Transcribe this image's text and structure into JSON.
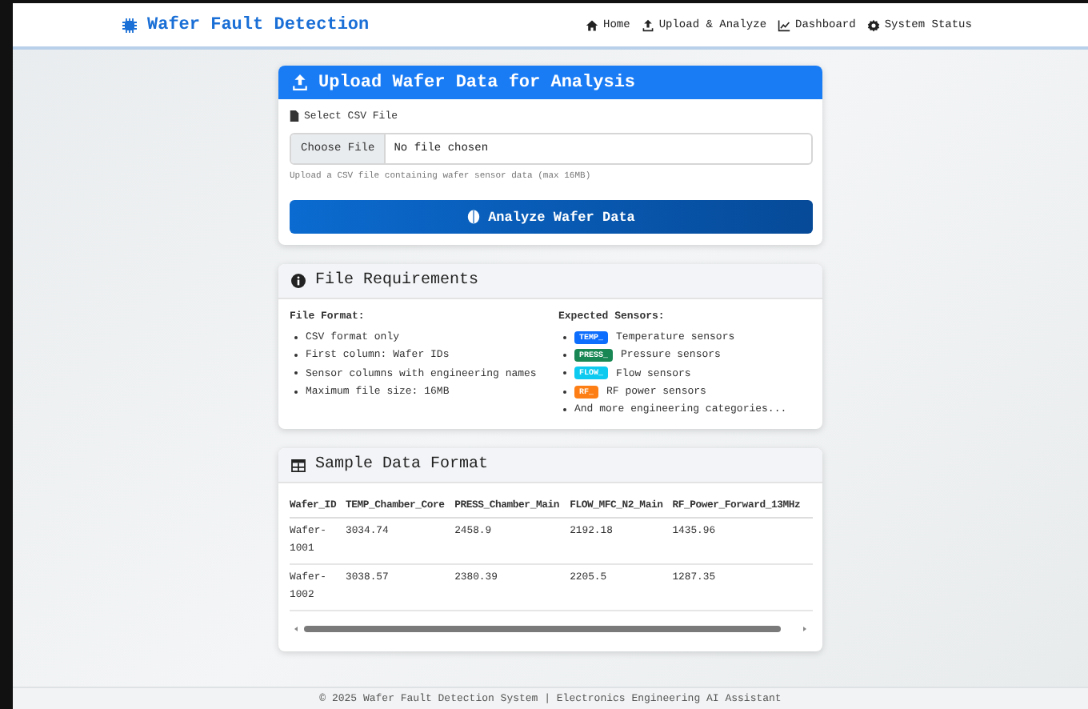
{
  "navbar": {
    "brand": "Wafer Fault Detection",
    "links": [
      {
        "label": "Home"
      },
      {
        "label": "Upload & Analyze"
      },
      {
        "label": "Dashboard"
      },
      {
        "label": "System Status"
      }
    ]
  },
  "upload": {
    "title": "Upload Wafer Data for Analysis",
    "field_label": "Select CSV File",
    "file_button": "Choose File",
    "file_status": "No file chosen",
    "help": "Upload a CSV file containing wafer sensor data (max 16MB)",
    "submit": "Analyze Wafer Data"
  },
  "requirements": {
    "title": "File Requirements",
    "format_heading": "File Format:",
    "format_items": [
      "CSV format only",
      "First column: Wafer IDs",
      "Sensor columns with engineering names",
      "Maximum file size: 16MB"
    ],
    "sensors_heading": "Expected Sensors:",
    "sensors": [
      {
        "tag": "TEMP_",
        "color": "#0d6efd",
        "text": "Temperature sensors"
      },
      {
        "tag": "PRESS_",
        "color": "#198754",
        "text": "Pressure sensors"
      },
      {
        "tag": "FLOW_",
        "color": "#0dcaf0",
        "text": "Flow sensors"
      },
      {
        "tag": "RF_",
        "color": "#fd7e14",
        "text": "RF power sensors"
      }
    ],
    "more": "And more engineering categories..."
  },
  "sample": {
    "title": "Sample Data Format",
    "columns": [
      "Wafer_ID",
      "TEMP_Chamber_Core",
      "PRESS_Chamber_Main",
      "FLOW_MFC_N2_Main",
      "RF_Power_Forward_13MHz"
    ],
    "rows": [
      [
        "Wafer-1001",
        "3034.74",
        "2458.9",
        "2192.18",
        "1435.96"
      ],
      [
        "Wafer-1002",
        "3038.57",
        "2380.39",
        "2205.5",
        "1287.35"
      ]
    ]
  },
  "footer": "© 2025 Wafer Fault Detection System | Electronics Engineering AI Assistant"
}
